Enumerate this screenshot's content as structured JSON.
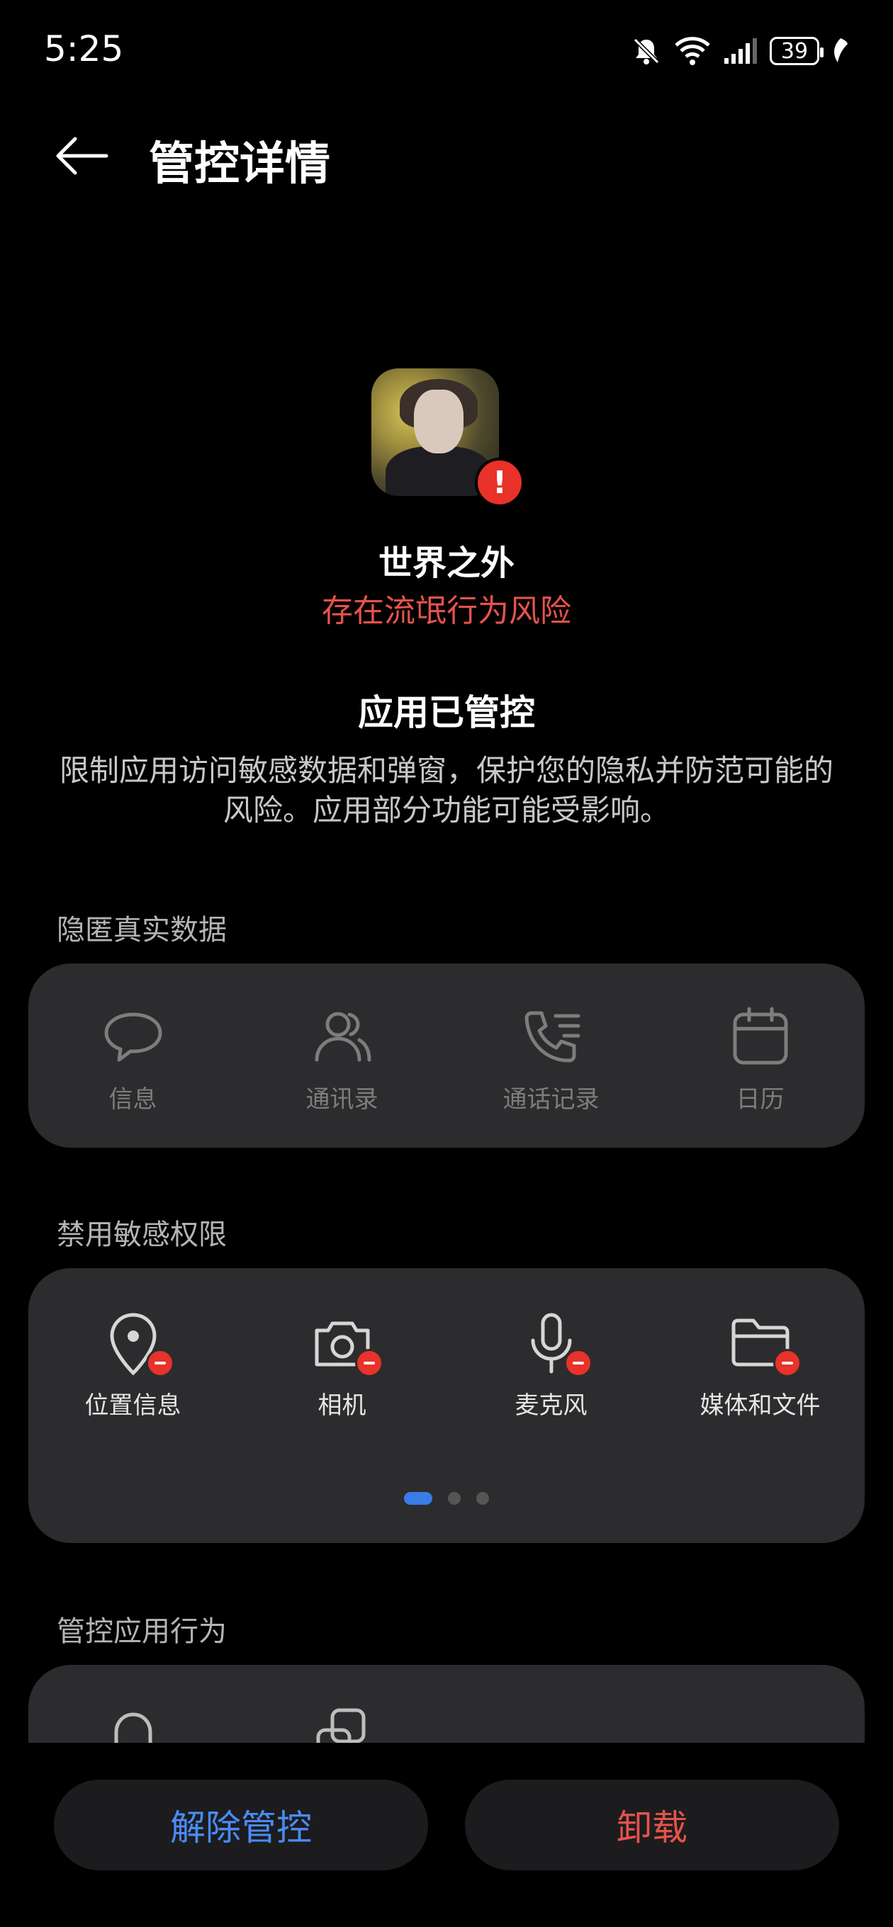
{
  "status_bar": {
    "time": "5:25",
    "battery": "39"
  },
  "header": {
    "title": "管控详情"
  },
  "app": {
    "name": "世界之外",
    "risk": "存在流氓行为风险",
    "status_title": "应用已管控",
    "description": "限制应用访问敏感数据和弹窗，保护您的隐私并防范可能的风险。应用部分功能可能受影响。"
  },
  "sections": {
    "hide_data": {
      "label": "隐匿真实数据",
      "items": [
        {
          "label": "信息",
          "icon": "message-icon"
        },
        {
          "label": "通讯录",
          "icon": "contacts-icon"
        },
        {
          "label": "通话记录",
          "icon": "call-log-icon"
        },
        {
          "label": "日历",
          "icon": "calendar-icon"
        }
      ]
    },
    "disabled_permissions": {
      "label": "禁用敏感权限",
      "items": [
        {
          "label": "位置信息",
          "icon": "location-icon"
        },
        {
          "label": "相机",
          "icon": "camera-icon"
        },
        {
          "label": "麦克风",
          "icon": "microphone-icon"
        },
        {
          "label": "媒体和文件",
          "icon": "folder-icon"
        }
      ],
      "pages": 3,
      "active_page": 1
    },
    "controlled_behavior": {
      "label": "管控应用行为",
      "items": [
        {
          "icon": "bell-icon"
        },
        {
          "icon": "app-link-icon"
        }
      ]
    }
  },
  "actions": {
    "release": "解除管控",
    "uninstall": "卸载"
  },
  "colors": {
    "accent_blue": "#4a8cf7",
    "danger_red": "#e5534b",
    "card_bg": "#2c2c2e"
  }
}
